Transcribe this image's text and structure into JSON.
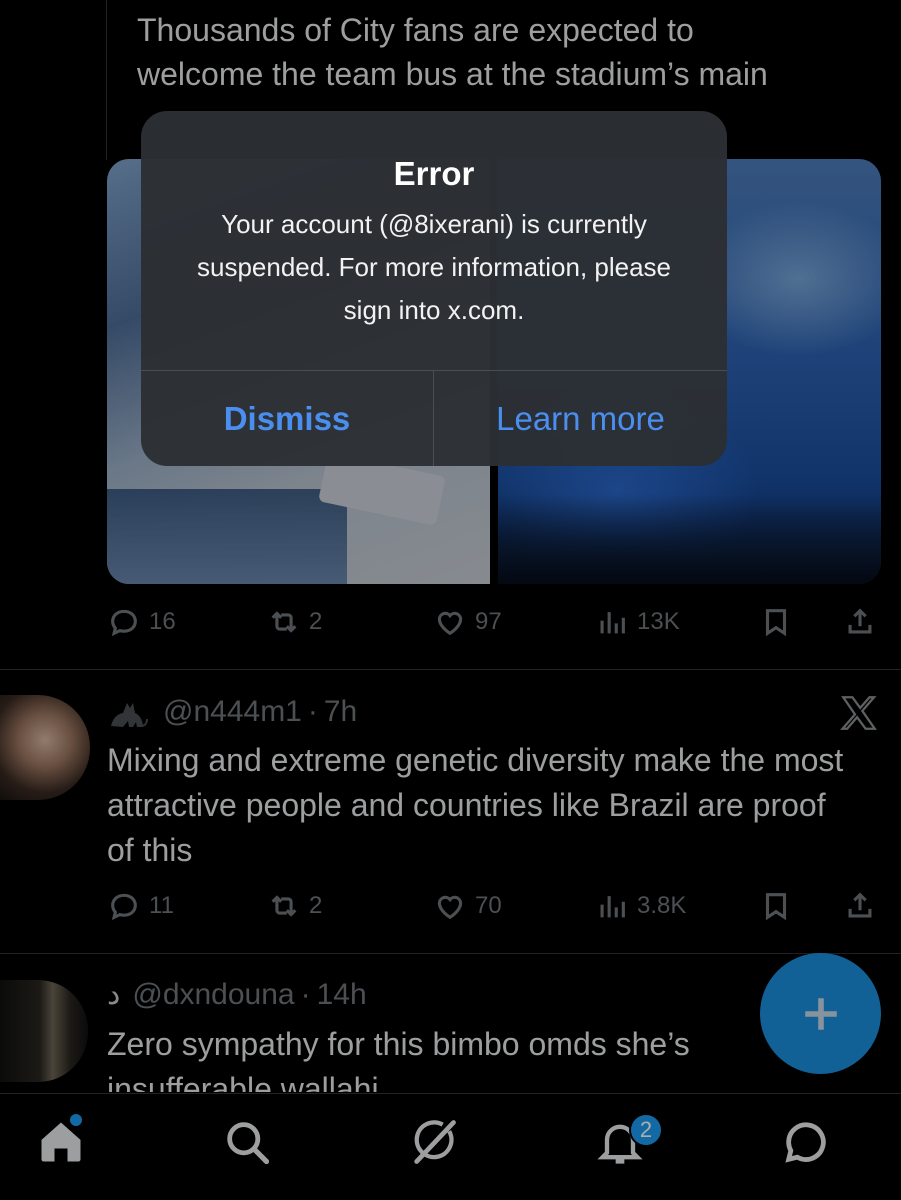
{
  "tweet1": {
    "text_line1": "Thousands of City fans are expected to",
    "text_line2": "welcome the team bus at the stadium’s main",
    "actions": {
      "replies": "16",
      "reposts": "2",
      "likes": "97",
      "views": "13K"
    }
  },
  "tweet2": {
    "handle": "@n444m1",
    "sep": "·",
    "time": "7h",
    "text": "Mixing and extreme genetic diversity make the most attractive people and countries like Brazil are proof of this",
    "actions": {
      "replies": "11",
      "reposts": "2",
      "likes": "70",
      "views": "3.8K"
    }
  },
  "tweet3": {
    "name_glyph": "د",
    "handle": "@dxndouna",
    "sep": "·",
    "time": "14h",
    "text_line1": "Zero sympathy for this bimbo omds she’s",
    "text_line2": "insufferable wallahi"
  },
  "alert": {
    "title": "Error",
    "message": "Your account (@8ixerani) is currently suspended. For more information, please sign into x.com.",
    "dismiss_label": "Dismiss",
    "learn_more_label": "Learn more"
  },
  "tabbar": {
    "notifications_badge": "2"
  },
  "colors": {
    "accent": "#1d9bf0",
    "alert_button": "#4a8ff0",
    "muted": "#71767b"
  },
  "icons": {
    "reply": "reply-icon",
    "repost": "repost-icon",
    "like": "heart-icon",
    "views": "views-icon",
    "bookmark": "bookmark-icon",
    "share": "share-icon",
    "compose": "plus-icon",
    "home": "home-icon",
    "search": "search-icon",
    "grok": "grok-icon",
    "notifications": "bell-icon",
    "messages": "chat-bubble-icon",
    "x": "x-logo-icon",
    "cat": "cat-icon"
  }
}
